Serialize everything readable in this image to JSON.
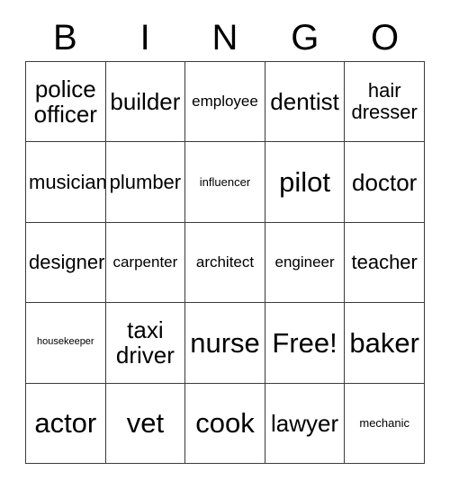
{
  "card": {
    "title": "BINGO",
    "header_letters": [
      "B",
      "I",
      "N",
      "G",
      "O"
    ],
    "border_color": "#3a3a3a",
    "background_color": "#ffffff",
    "text_color": "#000000",
    "rows": 5,
    "columns": 5,
    "free_space": {
      "label": "Free!",
      "row": 4,
      "column": 4
    },
    "cells": [
      [
        {
          "label": "police officer",
          "size": "lg"
        },
        {
          "label": "builder",
          "size": "lg"
        },
        {
          "label": "employee",
          "size": "sm"
        },
        {
          "label": "dentist",
          "size": "lg"
        },
        {
          "label": "hair dresser",
          "size": "md"
        }
      ],
      [
        {
          "label": "musician",
          "size": "md"
        },
        {
          "label": "plumber",
          "size": "md"
        },
        {
          "label": "influencer",
          "size": "xs"
        },
        {
          "label": "pilot",
          "size": "xl"
        },
        {
          "label": "doctor",
          "size": "lg"
        }
      ],
      [
        {
          "label": "designer",
          "size": "md"
        },
        {
          "label": "carpenter",
          "size": "sm"
        },
        {
          "label": "architect",
          "size": "sm"
        },
        {
          "label": "engineer",
          "size": "sm"
        },
        {
          "label": "teacher",
          "size": "md"
        }
      ],
      [
        {
          "label": "housekeeper",
          "size": "xxs"
        },
        {
          "label": "taxi driver",
          "size": "lg"
        },
        {
          "label": "nurse",
          "size": "xl"
        },
        {
          "label": "Free!",
          "size": "xl"
        },
        {
          "label": "baker",
          "size": "xl"
        }
      ],
      [
        {
          "label": "actor",
          "size": "xl"
        },
        {
          "label": "vet",
          "size": "xl"
        },
        {
          "label": "cook",
          "size": "xl"
        },
        {
          "label": "lawyer",
          "size": "lg"
        },
        {
          "label": "mechanic",
          "size": "xs"
        }
      ]
    ]
  }
}
